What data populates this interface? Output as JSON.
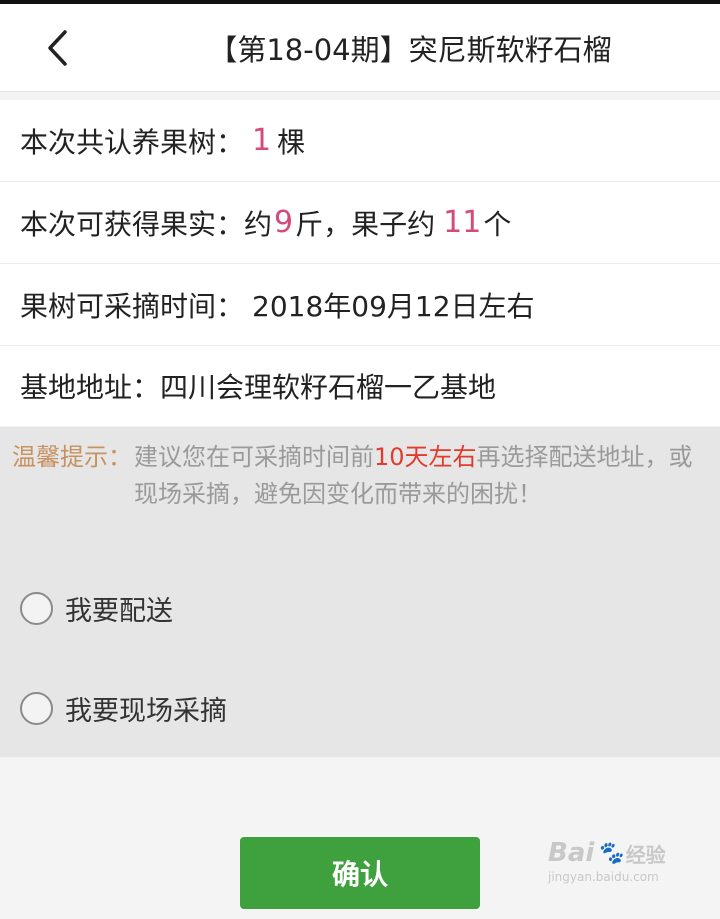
{
  "header": {
    "title": "【第18-04期】突尼斯软籽石榴"
  },
  "rows": {
    "tree_count": {
      "label": "本次共认养果树：",
      "value": "1",
      "unit": "棵"
    },
    "fruit_yield": {
      "label": "本次可获得果实：约",
      "weight": "9",
      "weight_unit": "斤，果子约",
      "count": "11",
      "count_unit": "个"
    },
    "pick_time": {
      "label": "果树可采摘时间：",
      "value": "2018年09月12日左右"
    },
    "base_address": {
      "label": "基地地址：",
      "value": "四川会理软籽石榴一乙基地"
    }
  },
  "tip": {
    "label": "温馨提示：",
    "text_before": "建议您在可采摘时间前",
    "highlight": "10天左右",
    "text_after": "再选择配送地址，或现场采摘，避免因变化而带来的困扰！"
  },
  "options": [
    {
      "label": "我要配送"
    },
    {
      "label": "我要现场采摘"
    }
  ],
  "confirm_label": "确认",
  "watermark": {
    "brand_left": "Bai",
    "brand_right": "经验",
    "url": "jingyan.baidu.com"
  },
  "colors": {
    "accent_green": "#3fa13d",
    "highlight_pink": "#d44a7b",
    "tip_red": "#e23b2e",
    "tip_label": "#c79261"
  },
  "icons": {
    "back": "chevron-left-icon",
    "radio": "radio-unchecked-icon",
    "watermark_paw": "paw-icon"
  }
}
